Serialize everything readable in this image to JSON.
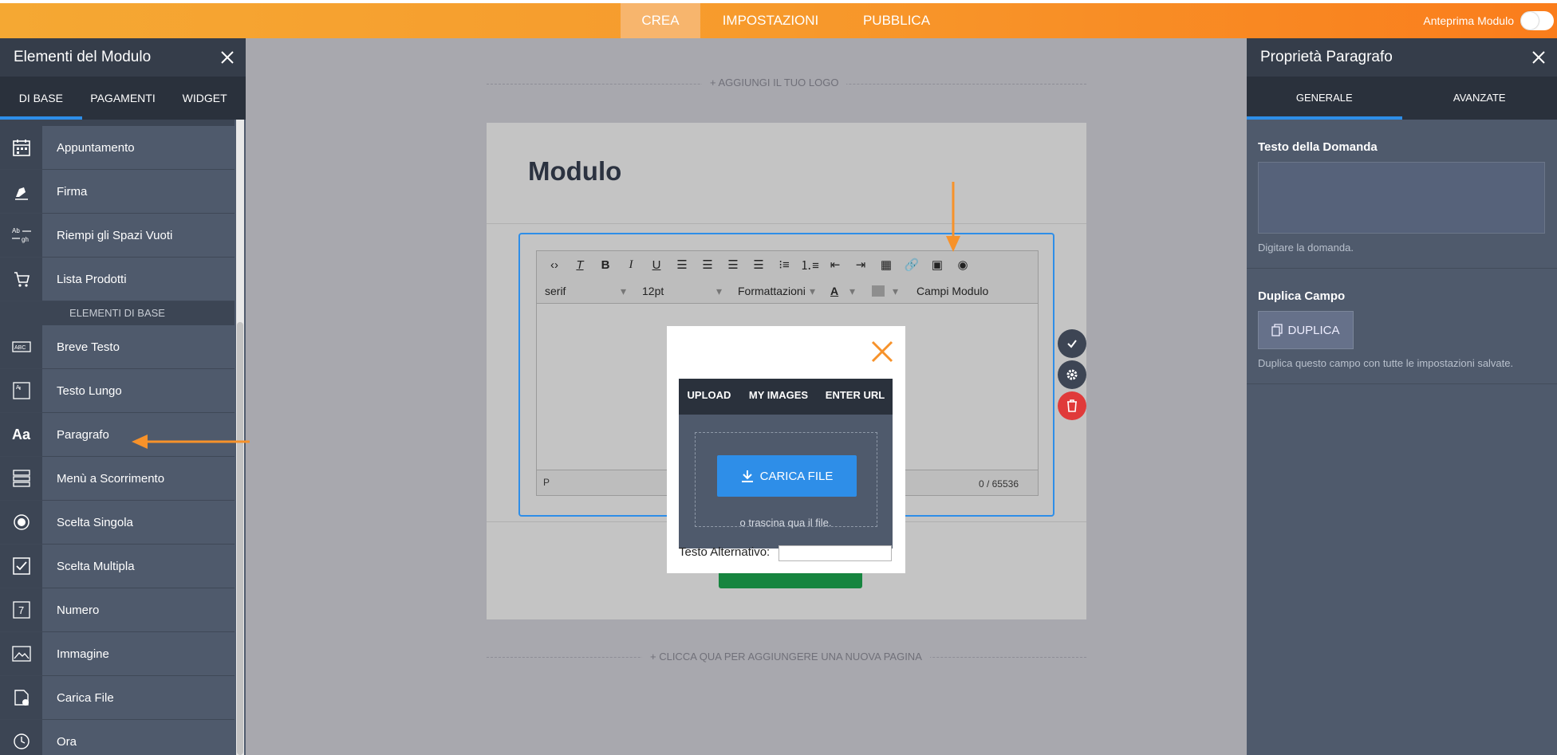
{
  "topbar": {
    "tabs": [
      "CREA",
      "IMPOSTAZIONI",
      "PUBBLICA"
    ],
    "active_tab": "CREA",
    "preview_label": "Anteprima Modulo"
  },
  "left_panel": {
    "title": "Elementi del Modulo",
    "tabs": [
      "DI BASE",
      "PAGAMENTI",
      "WIDGET"
    ],
    "active_tab": "DI BASE",
    "items_top": [
      {
        "label": "Appuntamento",
        "icon": "calendar-icon"
      },
      {
        "label": "Firma",
        "icon": "pen-icon"
      },
      {
        "label": "Riempi gli Spazi Vuoti",
        "icon": "fill-blanks-icon"
      },
      {
        "label": "Lista Prodotti",
        "icon": "cart-icon"
      }
    ],
    "section_header": "ELEMENTI DI BASE",
    "items_basic": [
      {
        "label": "Breve Testo",
        "icon": "short-text-icon"
      },
      {
        "label": "Testo Lungo",
        "icon": "long-text-icon"
      },
      {
        "label": "Paragrafo",
        "icon": "paragraph-icon"
      },
      {
        "label": "Menù a Scorrimento",
        "icon": "dropdown-icon"
      },
      {
        "label": "Scelta Singola",
        "icon": "radio-icon"
      },
      {
        "label": "Scelta Multipla",
        "icon": "checkbox-icon"
      },
      {
        "label": "Numero",
        "icon": "number-icon"
      },
      {
        "label": "Immagine",
        "icon": "image-icon"
      },
      {
        "label": "Carica File",
        "icon": "file-upload-icon"
      },
      {
        "label": "Ora",
        "icon": "clock-icon"
      }
    ]
  },
  "canvas": {
    "add_logo": "+ AGGIUNGI IL TUO LOGO",
    "form_title": "Modulo",
    "add_page": "+ CLICCA QUA PER AGGIUNGERE UNA NUOVA PAGINA",
    "editor": {
      "font": "serif",
      "size": "12pt",
      "formats": "Formattazioni",
      "fields": "Campi Modulo",
      "path": "P",
      "counter": "0 / 65536"
    }
  },
  "modal": {
    "tabs": [
      "UPLOAD",
      "MY IMAGES",
      "ENTER URL"
    ],
    "active_tab": "UPLOAD",
    "upload_button": "CARICA FILE",
    "drop_text": "o trascina qua il file.",
    "alt_label": "Testo Alternativo:"
  },
  "right_panel": {
    "title": "Proprietà Paragrafo",
    "tabs": [
      "GENERALE",
      "AVANZATE"
    ],
    "active_tab": "GENERALE",
    "question_label": "Testo della Domanda",
    "question_hint": "Digitare la domanda.",
    "duplicate_title": "Duplica Campo",
    "duplicate_button": "DUPLICA",
    "duplicate_hint": "Duplica questo campo con tutte le impostazioni salvate."
  },
  "colors": {
    "accent_orange": "#f7922a",
    "accent_blue": "#2e8ee8",
    "panel_bg": "#4f5a6c",
    "delete_red": "#e03a3a",
    "submit_green": "#16853f"
  }
}
